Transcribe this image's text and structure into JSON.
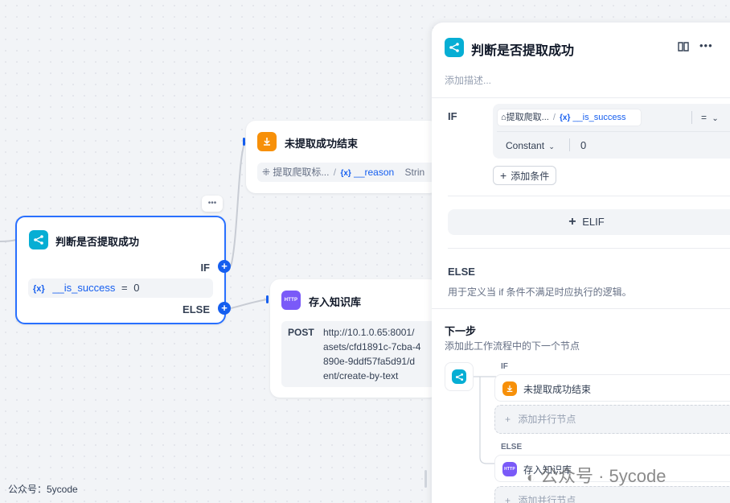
{
  "canvas": {
    "main_node": {
      "title": "判断是否提取成功",
      "if_label": "IF",
      "else_label": "ELSE",
      "cond_var": "__is_success",
      "cond_op": "=",
      "cond_val": "0",
      "more": "•••"
    },
    "end_node": {
      "title": "未提取成功结束",
      "src_node": "提取爬取标...",
      "sep": "/",
      "var": "__reason",
      "type": "Strin"
    },
    "http_node": {
      "title": "存入知识库",
      "method": "POST",
      "url_lines": [
        "http://10.1.0.65:8001/",
        "asets/cfd1891c-7cba-4",
        "890e-9ddf57fa5d91/d",
        "ent/create-by-text"
      ]
    },
    "watermark_left": "公众号：5ycode"
  },
  "panel": {
    "title": "判断是否提取成功",
    "description_placeholder": "添加描述...",
    "if_label": "IF",
    "cond_node": "提取爬取...",
    "cond_sep": "/",
    "cond_var": "__is_success",
    "cond_op": "=",
    "cond_type": "Constant",
    "cond_value": "0",
    "add_condition": "添加条件",
    "elif_label": "ELIF",
    "else_label": "ELSE",
    "else_desc": "用于定义当 if 条件不满足时应执行的逻辑。",
    "next_title": "下一步",
    "next_desc": "添加此工作流程中的下一个节点",
    "branch_if": "IF",
    "branch_if_node": "未提取成功结束",
    "add_parallel": "添加并行节点",
    "branch_else": "ELSE",
    "branch_else_node": "存入知识库",
    "add_parallel_2": "添加并行节点",
    "watermark": "公众号 · 5ycode"
  },
  "icons": {
    "branch": "branch-icon",
    "end": "end-icon",
    "http": "http-icon",
    "book": "book-icon",
    "more": "more-icon",
    "chevron": "chevron-down-icon"
  },
  "colors": {
    "accent": "#155eef",
    "cyan": "#06aed4",
    "orange": "#f79009",
    "purple": "#7a5af8"
  }
}
